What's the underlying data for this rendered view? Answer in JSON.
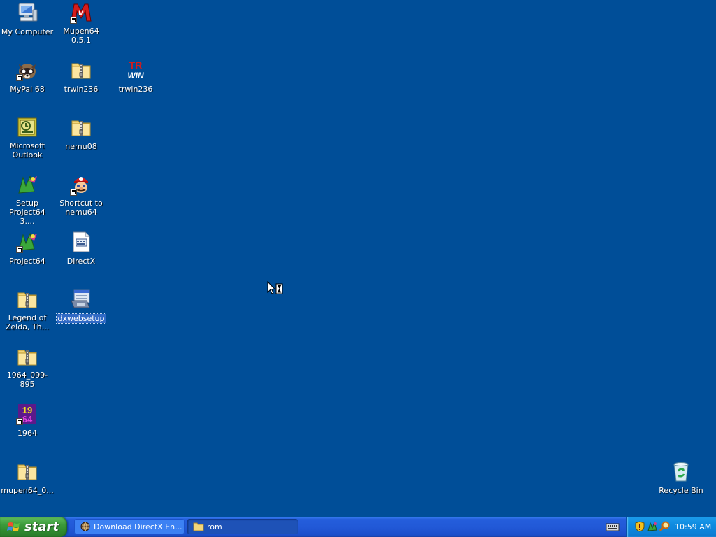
{
  "desktop": {
    "background_color": "#004E98",
    "selection_color": "#316AC5",
    "icons": [
      {
        "label": "My Computer",
        "icon": "my-computer-icon"
      },
      {
        "label": "Mupen64 0.5.1",
        "icon": "mupen64-icon"
      },
      {
        "label": "MyPal 68",
        "icon": "mypal-icon"
      },
      {
        "label": "trwin236",
        "icon": "zip-folder-icon"
      },
      {
        "label": "trwin236",
        "icon": "trwin-icon"
      },
      {
        "label": "Microsoft Outlook",
        "icon": "outlook-icon"
      },
      {
        "label": "nemu08",
        "icon": "zip-folder-icon"
      },
      {
        "label": "Setup Project64 3....",
        "icon": "project64-setup-icon"
      },
      {
        "label": "Shortcut to nemu64",
        "icon": "mario-icon"
      },
      {
        "label": "Project64",
        "icon": "project64-icon"
      },
      {
        "label": "DirectX",
        "icon": "text-file-icon"
      },
      {
        "label": "Legend of Zelda, Th...",
        "icon": "zip-folder-icon"
      },
      {
        "label": "dxwebsetup",
        "icon": "installer-icon"
      },
      {
        "label": "1964_099-895",
        "icon": "zip-folder-icon"
      },
      {
        "label": "1964",
        "icon": "emulator-1964-icon"
      },
      {
        "label": "mupen64_0...",
        "icon": "zip-folder-icon"
      },
      {
        "label": "Recycle Bin",
        "icon": "recycle-bin-icon"
      }
    ]
  },
  "taskbar": {
    "start_label": "start",
    "tasks": [
      {
        "label": "Download DirectX En...",
        "icon": "globe-icon"
      },
      {
        "label": "rom",
        "icon": "folder-icon"
      }
    ],
    "clock": "10:59 AM",
    "tray_icons": [
      "security-shield-icon",
      "network-icon",
      "search-icon"
    ]
  }
}
